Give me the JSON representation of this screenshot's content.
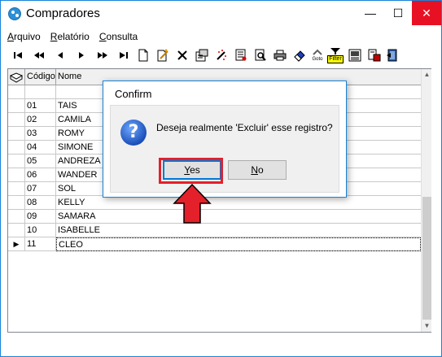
{
  "window": {
    "title": "Compradores",
    "controls": {
      "minimize": "—",
      "maximize": "☐",
      "close": "✕"
    }
  },
  "menu": [
    {
      "label_underlined": "A",
      "label_rest": "rquivo"
    },
    {
      "label_underlined": "R",
      "label_rest": "elatório"
    },
    {
      "label_underlined": "C",
      "label_rest": "onsulta"
    }
  ],
  "toolbar": [
    {
      "name": "first-record-icon",
      "glyph": "⏮"
    },
    {
      "name": "prior-page-icon",
      "glyph": "⏪"
    },
    {
      "name": "prior-record-icon",
      "glyph": "◀"
    },
    {
      "name": "next-record-icon",
      "glyph": "▶"
    },
    {
      "name": "next-page-icon",
      "glyph": "⏩"
    },
    {
      "name": "last-record-icon",
      "glyph": "⏭"
    },
    {
      "name": "new-document-icon",
      "glyph": "🗋"
    },
    {
      "name": "edit-icon",
      "glyph": "✎"
    },
    {
      "name": "delete-icon",
      "glyph": "✗"
    },
    {
      "name": "properties-icon",
      "glyph": "⚙"
    },
    {
      "name": "tools-icon",
      "glyph": "✦"
    },
    {
      "name": "list-icon",
      "glyph": "☰"
    },
    {
      "name": "preview-icon",
      "glyph": "🔍"
    },
    {
      "name": "print-icon",
      "glyph": "⎙"
    },
    {
      "name": "eraser-icon",
      "glyph": "◆"
    },
    {
      "name": "goto-icon",
      "glyph": "↪"
    },
    {
      "name": "filter-icon",
      "glyph": "▼"
    },
    {
      "name": "report-icon",
      "glyph": "▤"
    },
    {
      "name": "export-icon",
      "glyph": "⇲"
    },
    {
      "name": "exit-icon",
      "glyph": "⇥"
    }
  ],
  "toolbar_text": {
    "goto": "Goto",
    "filter": "Filter"
  },
  "grid": {
    "columns": [
      "Código",
      "Nome"
    ],
    "rows": [
      {
        "codigo": "",
        "nome": ""
      },
      {
        "codigo": "01",
        "nome": "TAIS"
      },
      {
        "codigo": "02",
        "nome": "CAMILA"
      },
      {
        "codigo": "03",
        "nome": "ROMY"
      },
      {
        "codigo": "04",
        "nome": "SIMONE"
      },
      {
        "codigo": "05",
        "nome": "ANDREZA"
      },
      {
        "codigo": "06",
        "nome": "WANDER"
      },
      {
        "codigo": "07",
        "nome": "SOL"
      },
      {
        "codigo": "08",
        "nome": "KELLY"
      },
      {
        "codigo": "09",
        "nome": "SAMARA"
      },
      {
        "codigo": "10",
        "nome": "ISABELLE"
      },
      {
        "codigo": "11",
        "nome": "CLEO"
      }
    ],
    "current_row_marker": "▶"
  },
  "dialog": {
    "title": "Confirm",
    "message": "Deseja realmente 'Excluir' esse registro?",
    "icon_glyph": "?",
    "yes_underlined": "Y",
    "yes_rest": "es",
    "no_underlined": "N",
    "no_rest": "o"
  },
  "colors": {
    "accent": "#1883d7",
    "close_button": "#e81123",
    "highlight": "#e4202a"
  }
}
